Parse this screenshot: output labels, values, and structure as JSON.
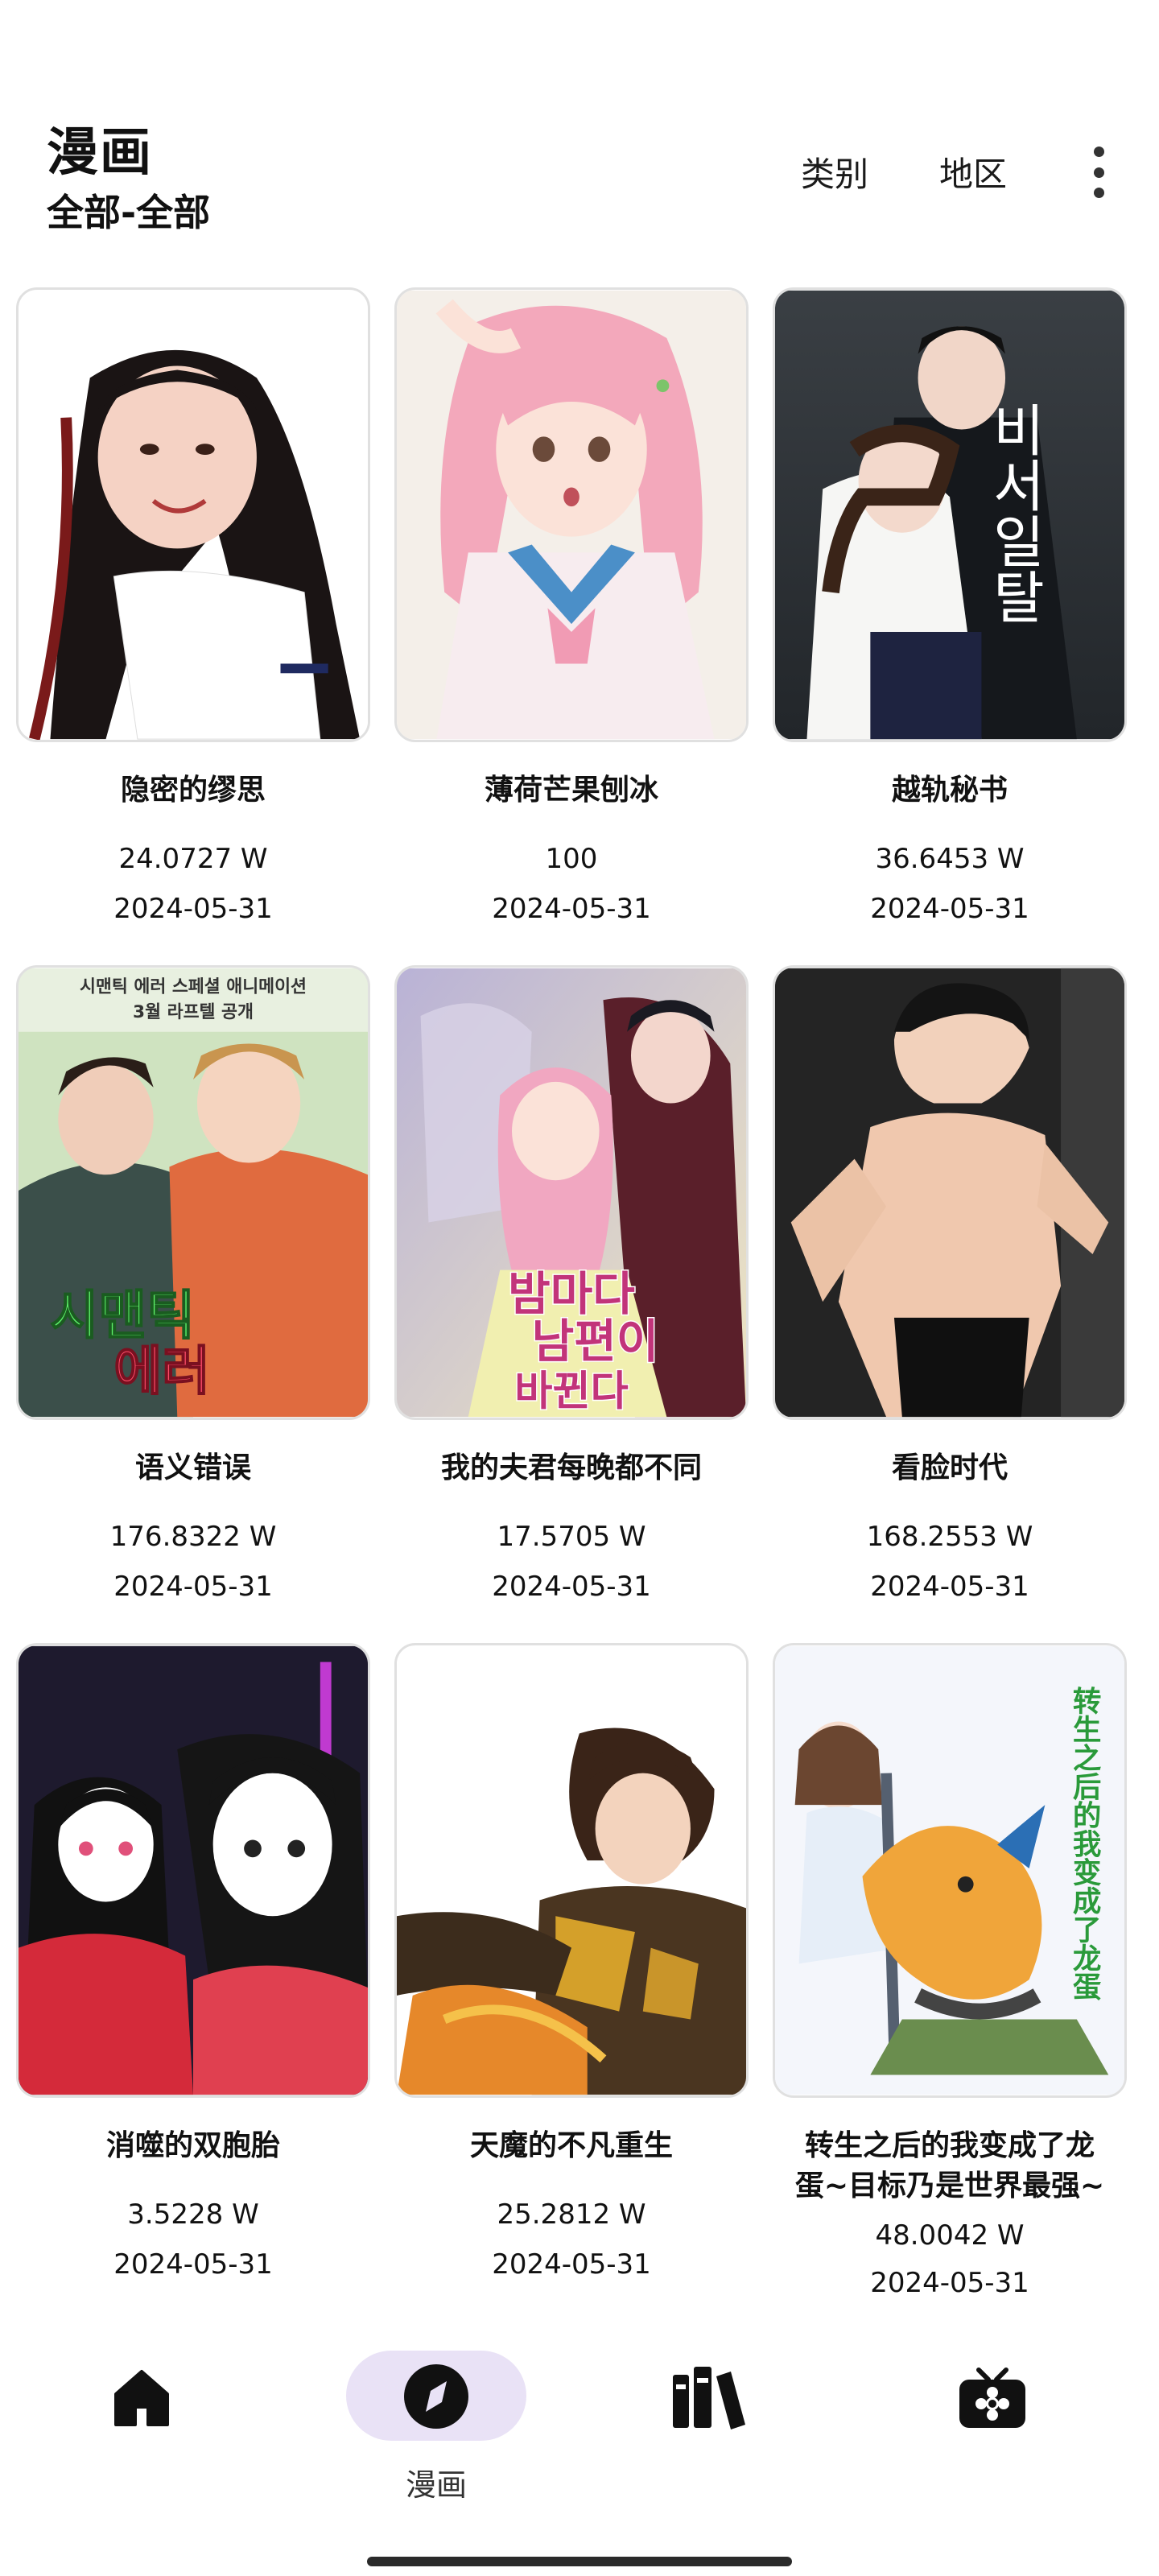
{
  "header": {
    "title": "漫画",
    "subtitle": "全部-全部",
    "category_label": "类别",
    "region_label": "地区"
  },
  "comics": [
    {
      "name": "隐密的缪思",
      "views": "24.0727 W",
      "date": "2024-05-31"
    },
    {
      "name": "薄荷芒果刨冰",
      "views": "100",
      "date": "2024-05-31"
    },
    {
      "name": "越轨秘书",
      "views": "36.6453 W",
      "date": "2024-05-31"
    },
    {
      "name": "语义错误",
      "views": "176.8322 W",
      "date": "2024-05-31"
    },
    {
      "name": "我的夫君每晚都不同",
      "views": "17.5705 W",
      "date": "2024-05-31"
    },
    {
      "name": "看脸时代",
      "views": "168.2553 W",
      "date": "2024-05-31"
    },
    {
      "name": "消噬的双胞胎",
      "views": "3.5228 W",
      "date": "2024-05-31"
    },
    {
      "name": "天魔的不凡重生",
      "views": "25.2812 W",
      "date": "2024-05-31"
    },
    {
      "name_line1": "转生之后的我变成了龙",
      "name_line2": "蛋~目标乃是世界最强~",
      "views": "48.0042 W",
      "date": "2024-05-31"
    }
  ],
  "cover_text": {
    "c3": "비서일탈",
    "c4_top": "시맨틱 에러 스페셜 애니메이션",
    "c4_sub": "3월 라프텔 공개",
    "c4_title1": "시맨틱",
    "c4_title2": "에러",
    "c5_title1": "밤마다",
    "c5_title2": "남편이",
    "c5_title3": "바뀐다",
    "c9_title": "转生之后的我变成了龙蛋"
  },
  "bottom_nav": {
    "items": [
      {
        "icon": "home-icon"
      },
      {
        "icon": "compass-icon",
        "label": "漫画",
        "active": true
      },
      {
        "icon": "bookshelf-icon"
      },
      {
        "icon": "tv-flower-icon"
      }
    ]
  },
  "colors": {
    "active_pill": "#e9e2f6",
    "text": "#111111"
  }
}
